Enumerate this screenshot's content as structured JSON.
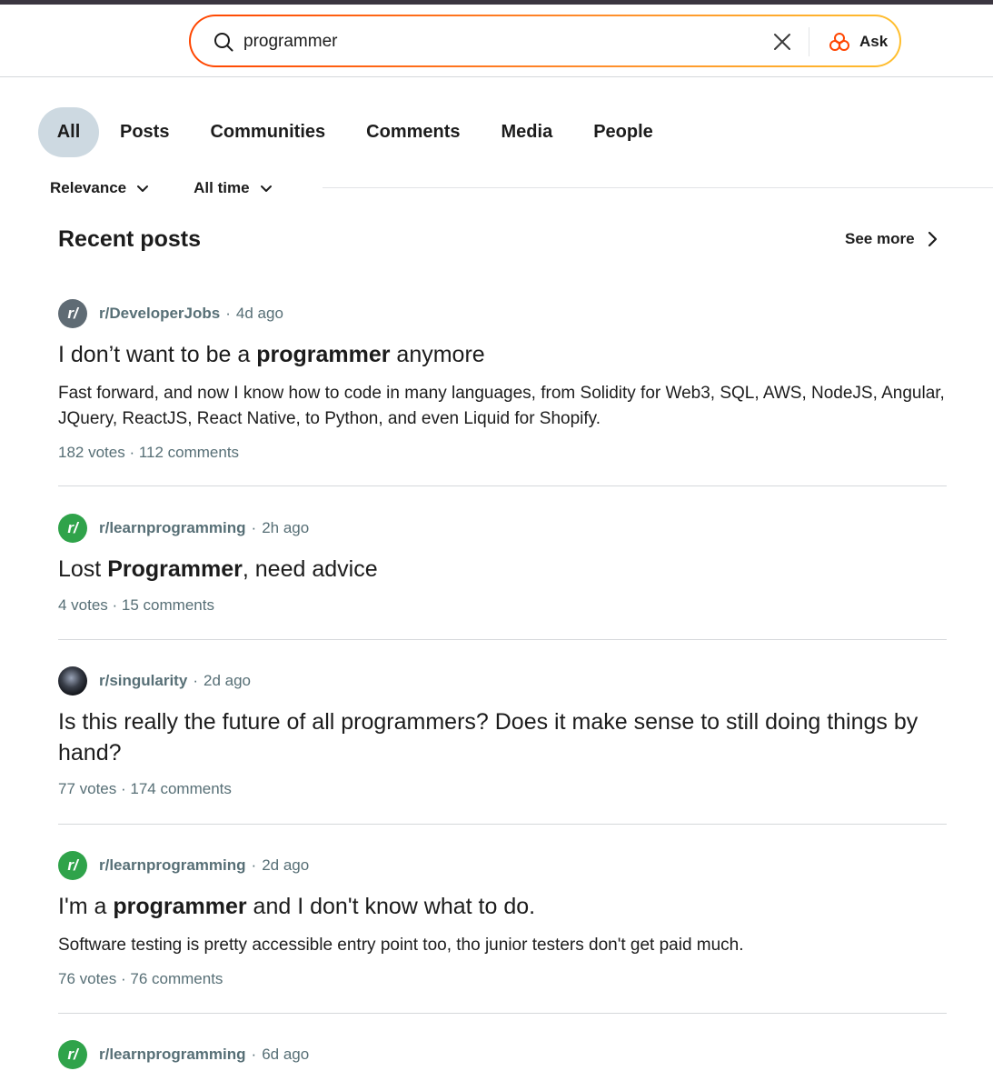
{
  "search": {
    "query": "programmer",
    "ask_label": "Ask"
  },
  "tabs": [
    {
      "label": "All",
      "active": true
    },
    {
      "label": "Posts"
    },
    {
      "label": "Communities"
    },
    {
      "label": "Comments"
    },
    {
      "label": "Media"
    },
    {
      "label": "People"
    }
  ],
  "filters": {
    "sort_label": "Relevance",
    "time_label": "All time"
  },
  "section": {
    "title": "Recent posts",
    "see_more": "See more"
  },
  "posts": [
    {
      "subreddit": "r/DeveloperJobs",
      "sep": "·",
      "time": "4d ago",
      "title_pre": "I don’t want to be a ",
      "title_bold": "programmer",
      "title_post": " anymore",
      "body": "Fast forward, and now I know how to code in many languages, from Solidity for Web3, SQL, AWS, NodeJS, Angular, JQuery, ReactJS, React Native, to Python, and even Liquid for Shopify.",
      "stats": "182 votes · 112 comments",
      "avatar_text": "r/"
    },
    {
      "subreddit": "r/learnprogramming",
      "sep": "·",
      "time": "2h ago",
      "title_pre": "Lost ",
      "title_bold": "Programmer",
      "title_post": ", need advice",
      "body": "",
      "stats": "4 votes · 15 comments",
      "avatar_text": "r/"
    },
    {
      "subreddit": "r/singularity",
      "sep": "·",
      "time": "2d ago",
      "title_pre": "Is this really the future of all programmers? Does it make sense to still doing things by hand?",
      "title_bold": "",
      "title_post": "",
      "body": "",
      "stats": "77 votes · 174 comments",
      "avatar_text": ""
    },
    {
      "subreddit": "r/learnprogramming",
      "sep": "·",
      "time": "2d ago",
      "title_pre": "I'm a ",
      "title_bold": "programmer",
      "title_post": " and I don't know what to do.",
      "body": "Software testing is pretty accessible entry point too, tho junior testers don't get paid much.",
      "stats": "76 votes · 76 comments",
      "avatar_text": "r/"
    },
    {
      "subreddit": "r/learnprogramming",
      "sep": "·",
      "time": "6d ago",
      "avatar_text": "r/"
    }
  ]
}
